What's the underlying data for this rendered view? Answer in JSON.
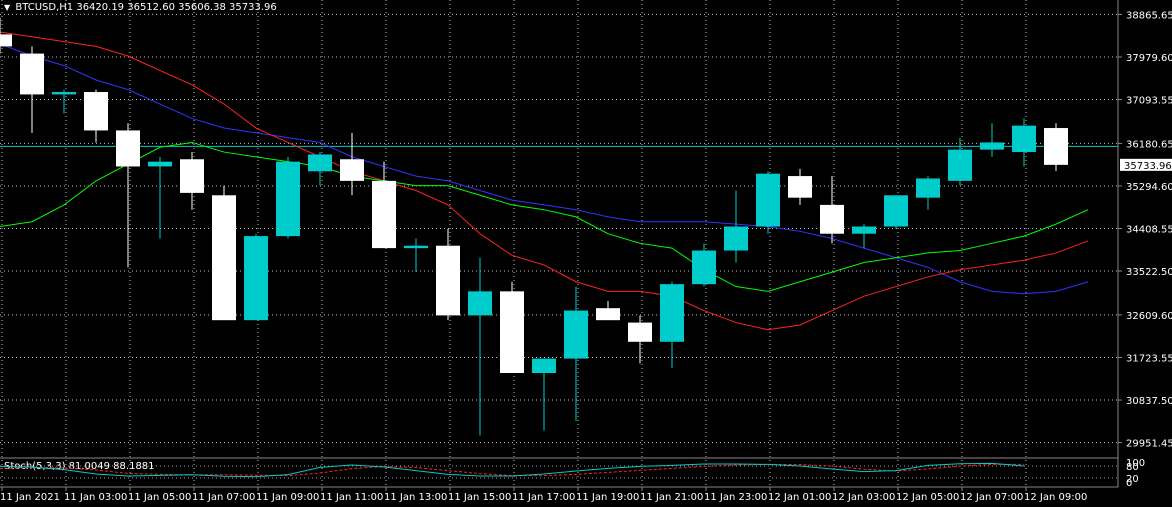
{
  "header": {
    "symbol": "BTCUSD,H1",
    "ohlc": "36420.19 36512.60 35606.38 35733.96"
  },
  "subwindow": {
    "label": "Stoch(5,3,3) 81.0049 88.1881"
  },
  "colors": {
    "background": "#000000",
    "grid": "#ffffff",
    "bull": "#00cccc",
    "bear": "#ffffff",
    "ma_fast": "#00ff00",
    "ma_mid": "#ff2222",
    "ma_slow": "#3333ff",
    "level_line": "#00cccc",
    "stoch_main": "#00cccc",
    "stoch_signal": "#ff2222"
  },
  "chart_data": [
    {
      "type": "candlestick",
      "y_ticks": [
        38865.65,
        37979.6,
        37093.55,
        36180.65,
        35294.6,
        34408.55,
        33522.5,
        32609.6,
        31723.55,
        30837.5,
        29951.45
      ],
      "ylim": [
        29651.45,
        39165.65
      ],
      "current_price_label": "35733.96",
      "x_tick_labels": [
        "11 Jan 2021",
        "11 Jan 03:00",
        "11 Jan 05:00",
        "11 Jan 07:00",
        "11 Jan 09:00",
        "11 Jan 11:00",
        "11 Jan 13:00",
        "11 Jan 15:00",
        "11 Jan 17:00",
        "11 Jan 19:00",
        "11 Jan 21:00",
        "11 Jan 23:00",
        "12 Jan 01:00",
        "12 Jan 03:00",
        "12 Jan 05:00",
        "12 Jan 07:00",
        "12 Jan 09:00"
      ],
      "candles": [
        {
          "o": 38450,
          "h": 38800,
          "l": 38050,
          "c": 38200
        },
        {
          "o": 38050,
          "h": 38200,
          "l": 36400,
          "c": 37200
        },
        {
          "o": 37200,
          "h": 37300,
          "l": 36800,
          "c": 37250
        },
        {
          "o": 37250,
          "h": 37300,
          "l": 36200,
          "c": 36450
        },
        {
          "o": 36450,
          "h": 36600,
          "l": 33600,
          "c": 35700
        },
        {
          "o": 35700,
          "h": 35900,
          "l": 34200,
          "c": 35800
        },
        {
          "o": 35850,
          "h": 36000,
          "l": 34800,
          "c": 35150
        },
        {
          "o": 35100,
          "h": 35300,
          "l": 32500,
          "c": 32500
        },
        {
          "o": 32500,
          "h": 34300,
          "l": 32500,
          "c": 34250
        },
        {
          "o": 34250,
          "h": 35900,
          "l": 34200,
          "c": 35800
        },
        {
          "o": 35600,
          "h": 36000,
          "l": 35300,
          "c": 35950
        },
        {
          "o": 35850,
          "h": 36400,
          "l": 35100,
          "c": 35400
        },
        {
          "o": 35400,
          "h": 35800,
          "l": 34400,
          "c": 34000
        },
        {
          "o": 34000,
          "h": 34200,
          "l": 33500,
          "c": 34050
        },
        {
          "o": 34050,
          "h": 34400,
          "l": 32500,
          "c": 32600
        },
        {
          "o": 32600,
          "h": 33800,
          "l": 30100,
          "c": 33100
        },
        {
          "o": 33100,
          "h": 33300,
          "l": 31400,
          "c": 31400
        },
        {
          "o": 31400,
          "h": 31700,
          "l": 30200,
          "c": 31700
        },
        {
          "o": 31700,
          "h": 33200,
          "l": 30400,
          "c": 32700
        },
        {
          "o": 32750,
          "h": 32900,
          "l": 32500,
          "c": 32500
        },
        {
          "o": 32450,
          "h": 32600,
          "l": 31600,
          "c": 32050
        },
        {
          "o": 32050,
          "h": 33300,
          "l": 31500,
          "c": 33250
        },
        {
          "o": 33250,
          "h": 34100,
          "l": 33200,
          "c": 33950
        },
        {
          "o": 33950,
          "h": 35200,
          "l": 33700,
          "c": 34450
        },
        {
          "o": 34450,
          "h": 35600,
          "l": 34300,
          "c": 35550
        },
        {
          "o": 35500,
          "h": 35650,
          "l": 34900,
          "c": 35050
        },
        {
          "o": 34900,
          "h": 35500,
          "l": 34100,
          "c": 34300
        },
        {
          "o": 34300,
          "h": 34500,
          "l": 34000,
          "c": 34450
        },
        {
          "o": 34450,
          "h": 35100,
          "l": 34400,
          "c": 35100
        },
        {
          "o": 35050,
          "h": 35500,
          "l": 34800,
          "c": 35450
        },
        {
          "o": 35400,
          "h": 36300,
          "l": 35300,
          "c": 36050
        },
        {
          "o": 36050,
          "h": 36600,
          "l": 35900,
          "c": 36200
        },
        {
          "o": 36000,
          "h": 36700,
          "l": 35700,
          "c": 36550
        },
        {
          "o": 36500,
          "h": 36600,
          "l": 35606.38,
          "c": 35733.96
        }
      ],
      "ma_fast": [
        34450,
        34550,
        34900,
        35400,
        35750,
        36100,
        36200,
        36000,
        35900,
        35800,
        35700,
        35500,
        35400,
        35300,
        35300,
        35100,
        34900,
        34800,
        34650,
        34300,
        34100,
        34000,
        33550,
        33200,
        33100,
        33300,
        33500,
        33700,
        33800,
        33900,
        33950,
        34100,
        34250,
        34500,
        34800
      ],
      "ma_mid": [
        38500,
        38400,
        38300,
        38200,
        38000,
        37700,
        37400,
        37000,
        36500,
        36200,
        35900,
        35600,
        35400,
        35200,
        34900,
        34300,
        33850,
        33650,
        33300,
        33100,
        33100,
        33000,
        32700,
        32450,
        32300,
        32400,
        32700,
        33000,
        33200,
        33400,
        33550,
        33650,
        33750,
        33900,
        34150
      ],
      "ma_slow": [
        38250,
        38000,
        37800,
        37500,
        37300,
        37000,
        36700,
        36500,
        36400,
        36300,
        36200,
        35900,
        35700,
        35500,
        35400,
        35200,
        35000,
        34900,
        34800,
        34650,
        34550,
        34550,
        34550,
        34500,
        34450,
        34350,
        34200,
        34000,
        33800,
        33600,
        33300,
        33100,
        33050,
        33100,
        33300
      ],
      "series_labels": []
    },
    {
      "type": "line",
      "y_ticks": [
        100,
        80,
        20,
        0
      ],
      "ylim": [
        0,
        100
      ],
      "main": [
        78,
        75,
        62,
        40,
        30,
        33,
        36,
        29,
        27,
        37,
        73,
        85,
        75,
        57,
        38,
        30,
        30,
        40,
        55,
        68,
        78,
        83,
        90,
        90,
        88,
        80,
        65,
        52,
        57,
        83,
        91,
        93,
        80
      ],
      "signal": [
        68,
        72,
        70,
        60,
        43,
        38,
        36,
        36,
        34,
        32,
        45,
        67,
        78,
        72,
        57,
        42,
        32,
        32,
        38,
        48,
        58,
        68,
        78,
        85,
        88,
        87,
        80,
        64,
        55,
        65,
        80,
        88,
        88
      ]
    }
  ]
}
